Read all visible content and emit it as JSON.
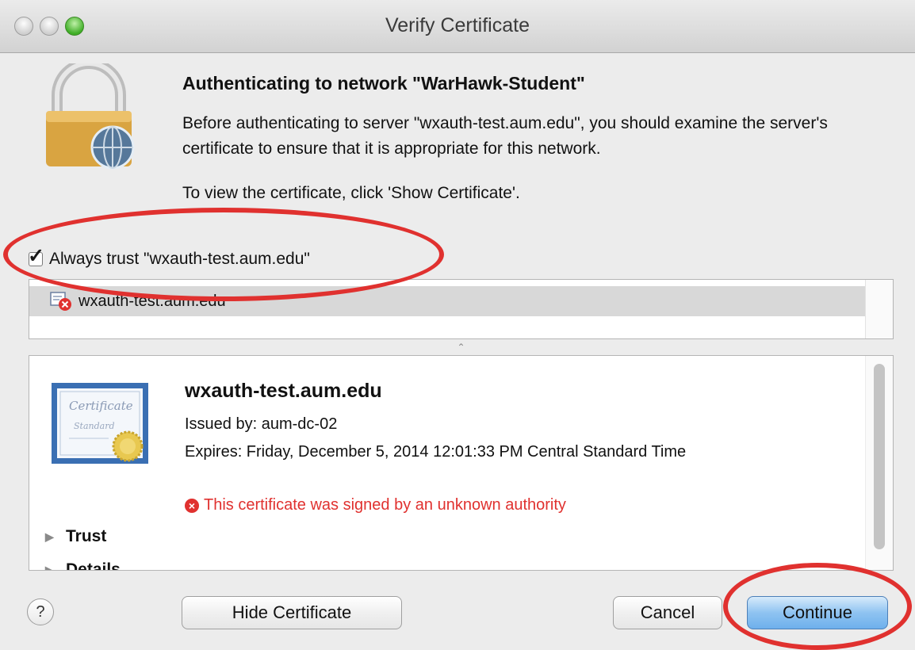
{
  "window": {
    "title": "Verify Certificate"
  },
  "dialog": {
    "heading": "Authenticating to network \"WarHawk-Student\"",
    "message": "Before authenticating to server \"wxauth-test.aum.edu\", you should examine the server's certificate to ensure that it is appropriate for this network.",
    "instruction": "To view the certificate, click 'Show Certificate'.",
    "always_trust_label": "Always trust \"wxauth-test.aum.edu\"",
    "always_trust_checked": true
  },
  "certificate_list": {
    "items": [
      {
        "name": "wxauth-test.aum.edu",
        "icon": "certificate-error-icon"
      }
    ]
  },
  "certificate": {
    "name": "wxauth-test.aum.edu",
    "issued_by": "Issued by: aum-dc-02",
    "expires": "Expires: Friday, December 5, 2014 12:01:33 PM Central Standard Time",
    "error": "This certificate was signed by an unknown authority",
    "badge_lines": [
      "Certificate",
      "Standard"
    ],
    "sections": [
      "Trust",
      "Details"
    ]
  },
  "buttons": {
    "help": "?",
    "hide_certificate": "Hide Certificate",
    "cancel": "Cancel",
    "continue": "Continue"
  },
  "colors": {
    "error": "#e0312f",
    "annotation": "#e0312f",
    "primary_button": "#8fc3f1"
  }
}
